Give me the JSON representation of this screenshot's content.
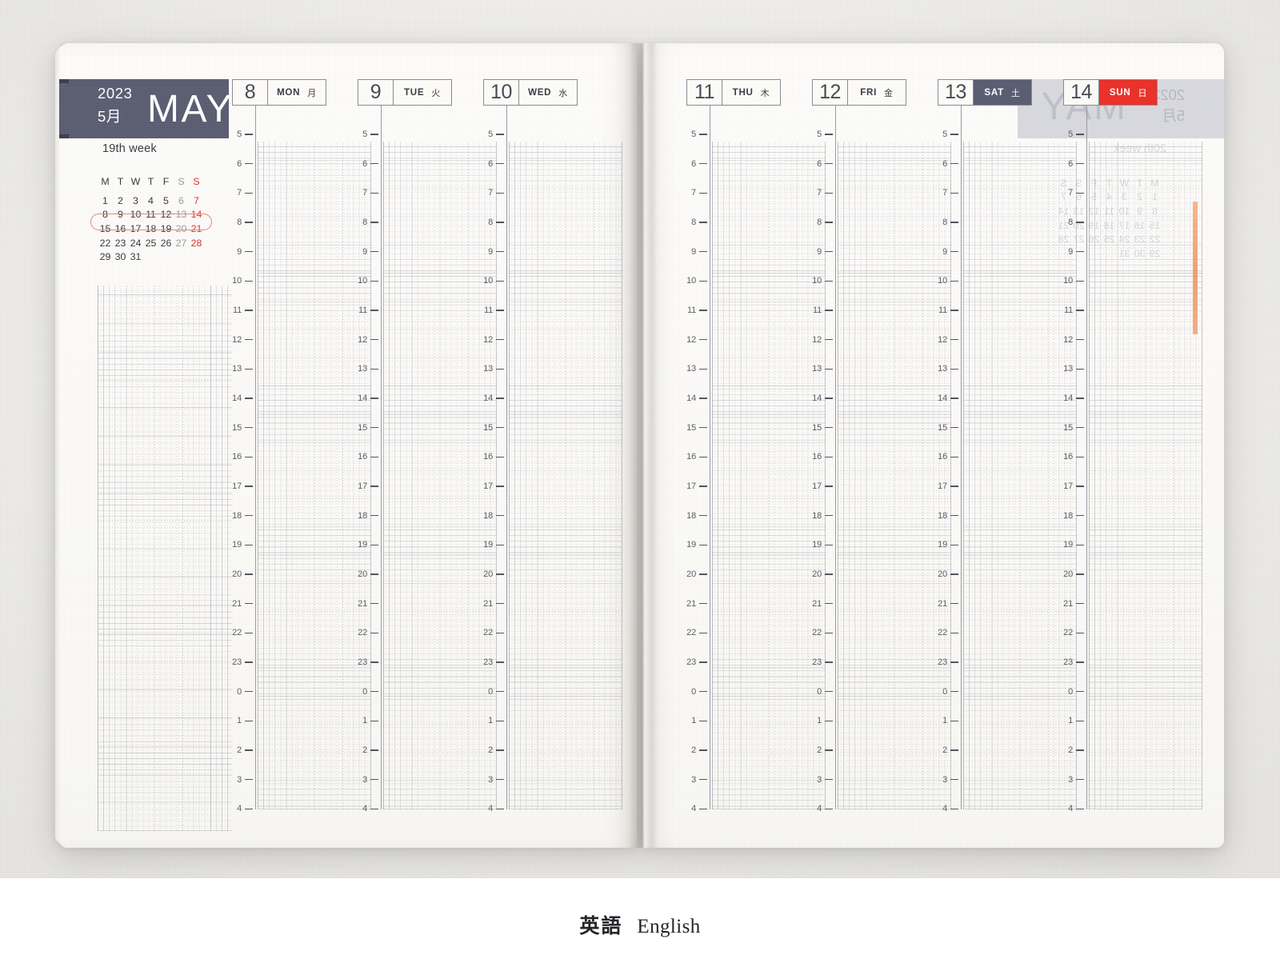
{
  "caption": {
    "japanese": "英語",
    "english": "English"
  },
  "banner": {
    "year": "2023",
    "month_jp": "5月",
    "month_en": "MAY",
    "week_label": "19th week",
    "bg_color": "#5b5d72"
  },
  "mini_calendar": {
    "dow": [
      "M",
      "T",
      "W",
      "T",
      "F",
      "S",
      "S"
    ],
    "weeks": [
      [
        "1",
        "2",
        "3",
        "4",
        "5",
        "6",
        "7"
      ],
      [
        "8",
        "9",
        "10",
        "11",
        "12",
        "13",
        "14"
      ],
      [
        "15",
        "16",
        "17",
        "18",
        "19",
        "20",
        "21"
      ],
      [
        "22",
        "23",
        "24",
        "25",
        "26",
        "27",
        "28"
      ],
      [
        "29",
        "30",
        "31",
        "",
        "",
        "",
        ""
      ]
    ],
    "highlighted_week_index": 1,
    "saturday_color": "#9b9ba3",
    "sunday_color": "#e0352b",
    "ring_color": "#dd8b7e"
  },
  "days": [
    {
      "num": "8",
      "abbr": "MON",
      "kanji": "月",
      "kind": "weekday",
      "page": "left"
    },
    {
      "num": "9",
      "abbr": "TUE",
      "kanji": "火",
      "kind": "weekday",
      "page": "left"
    },
    {
      "num": "10",
      "abbr": "WED",
      "kanji": "水",
      "kind": "weekday",
      "page": "left"
    },
    {
      "num": "11",
      "abbr": "THU",
      "kanji": "木",
      "kind": "weekday",
      "page": "right"
    },
    {
      "num": "12",
      "abbr": "FRI",
      "kanji": "金",
      "kind": "weekday",
      "page": "right"
    },
    {
      "num": "13",
      "abbr": "SAT",
      "kanji": "土",
      "kind": "saturday",
      "page": "right"
    },
    {
      "num": "14",
      "abbr": "SUN",
      "kanji": "日",
      "kind": "sunday",
      "page": "right"
    }
  ],
  "hours": [
    "5",
    "6",
    "7",
    "8",
    "9",
    "10",
    "11",
    "12",
    "13",
    "14",
    "15",
    "16",
    "17",
    "18",
    "19",
    "20",
    "21",
    "22",
    "23",
    "0",
    "1",
    "2",
    "3",
    "4"
  ],
  "colors": {
    "navy": "#5b5d72",
    "red": "#e8322a",
    "paper": "#fbfaf7",
    "rule": "#8a8a96",
    "grid_dot": "#8482968f"
  },
  "ghost_next_page": {
    "year": "2023",
    "month_jp": "5月",
    "month_en": "MAY",
    "week_label": "20th week",
    "dow": [
      "M",
      "T",
      "W",
      "T",
      "F",
      "S",
      "S"
    ],
    "weeks": [
      [
        "1",
        "2",
        "3",
        "4",
        "5",
        "6",
        "7"
      ],
      [
        "8",
        "9",
        "10",
        "11",
        "12",
        "13",
        "14"
      ],
      [
        "15",
        "16",
        "17",
        "18",
        "19",
        "20",
        "21"
      ],
      [
        "22",
        "23",
        "24",
        "25",
        "26",
        "27",
        "28"
      ],
      [
        "29",
        "30",
        "31",
        "",
        "",
        "",
        ""
      ]
    ]
  }
}
